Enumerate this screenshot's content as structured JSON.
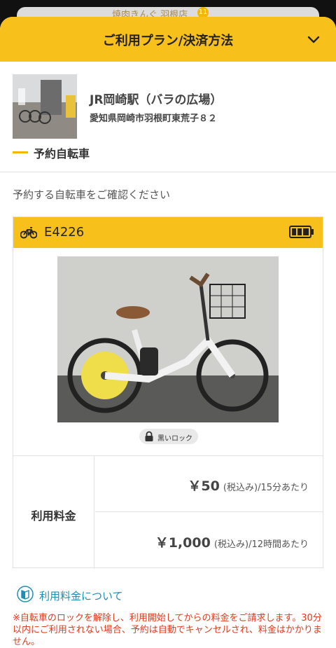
{
  "map_peek": {
    "text": "焼肉きんぐ 羽根店",
    "badge": "11"
  },
  "sheet": {
    "title": "ご利用プラン/決済方法"
  },
  "station": {
    "name": "JR岡崎駅（バラの広場）",
    "address": "愛知県岡崎市羽根町東荒子８２",
    "tab_label": "予約自転車"
  },
  "confirm_text": "予約する自転車をご確認ください",
  "bike": {
    "id": "E4226",
    "battery_level": 1.0,
    "lock_label": "黒いロック"
  },
  "fees": {
    "label": "利用料金",
    "rows": [
      {
        "price": "￥50",
        "tax": "(税込み)",
        "per": "/15分あたり"
      },
      {
        "price": "￥1,000",
        "tax": "(税込み)",
        "per": "/12時間あたり"
      }
    ]
  },
  "about_link": "利用料金について",
  "notice": "※自転車のロックを解除し、利用開始してからの料金をご請求します。30分以内にご利用されない場合、予約は自動でキャンセルされ、料金はかかりません。",
  "colors": {
    "accent": "#f7c01a",
    "link": "#1c8fb2",
    "warning": "#e03a1e"
  }
}
